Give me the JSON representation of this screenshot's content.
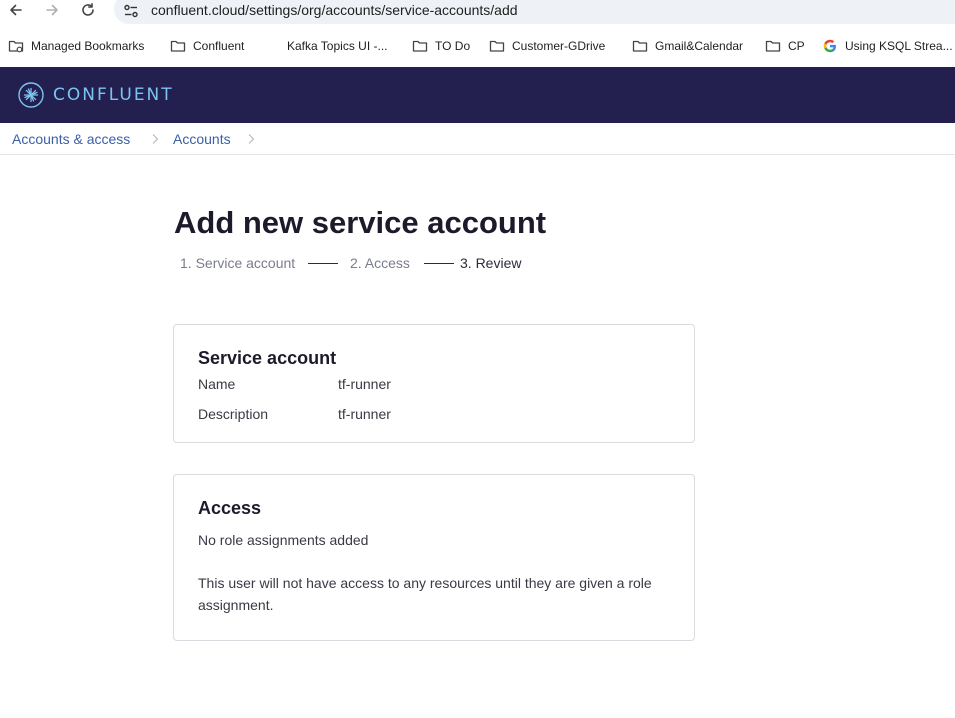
{
  "browser": {
    "url": "confluent.cloud/settings/org/accounts/service-accounts/add",
    "bookmarks": [
      {
        "label": "Managed Bookmarks",
        "icon": "managed-folder-icon"
      },
      {
        "label": "Confluent",
        "icon": "folder-icon"
      },
      {
        "label": "Kafka Topics UI -...",
        "icon": "blank-page-icon"
      },
      {
        "label": "TO Do",
        "icon": "folder-icon"
      },
      {
        "label": "Customer-GDrive",
        "icon": "folder-icon"
      },
      {
        "label": "Gmail&Calendar",
        "icon": "folder-icon"
      },
      {
        "label": "CP",
        "icon": "folder-icon"
      },
      {
        "label": "Using KSQL Strea...",
        "icon": "google-icon"
      }
    ]
  },
  "header": {
    "logo_text": "CONFLUENT",
    "brand_color": "#231f4f",
    "logo_color": "#7cc4f0"
  },
  "breadcrumb": {
    "items": [
      "Accounts & access",
      "Accounts"
    ]
  },
  "page": {
    "title": "Add new service account",
    "steps": [
      {
        "label": "1. Service account",
        "state": "done"
      },
      {
        "label": "2. Access",
        "state": "done"
      },
      {
        "label": "3. Review",
        "state": "current"
      }
    ]
  },
  "service_account_card": {
    "title": "Service account",
    "fields": [
      {
        "label": "Name",
        "value": "tf-runner"
      },
      {
        "label": "Description",
        "value": "tf-runner"
      }
    ]
  },
  "access_card": {
    "title": "Access",
    "empty_text": "No role assignments added",
    "note": "This user will not have access to any resources until they are given a role assignment."
  }
}
